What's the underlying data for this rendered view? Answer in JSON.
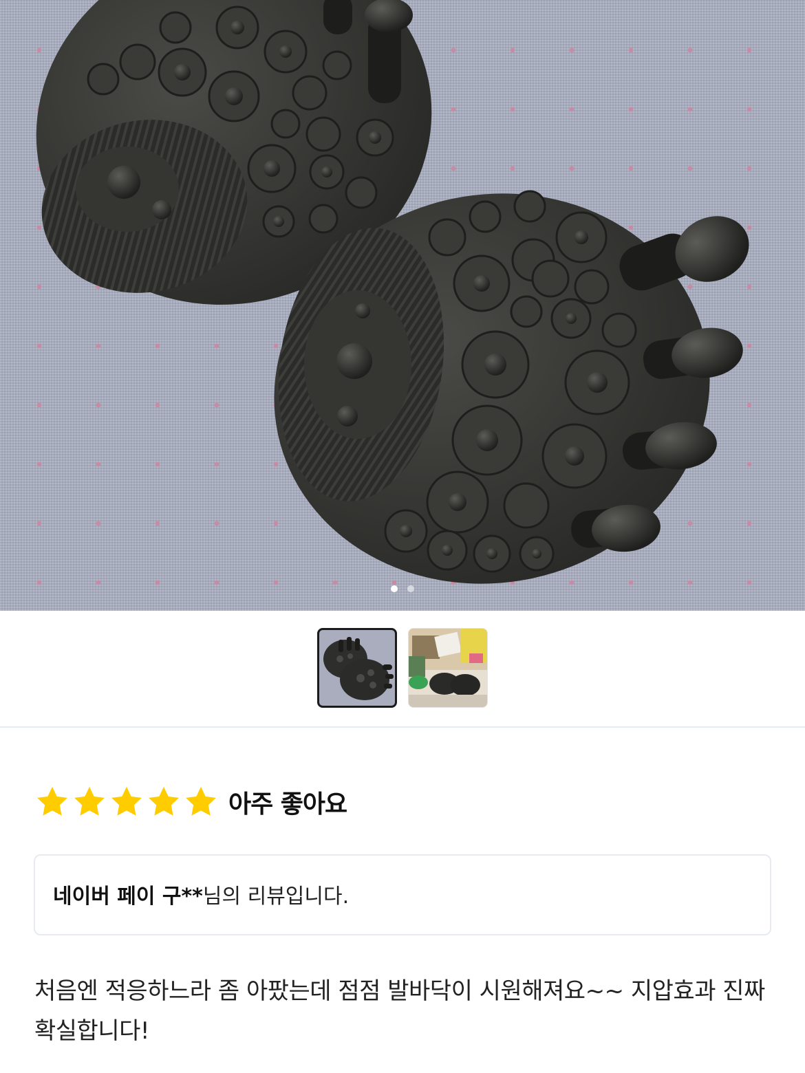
{
  "gallery": {
    "main_image_alt": "foot massage insoles",
    "current_index": 1,
    "total": 2,
    "thumbnails": [
      {
        "name": "thumbnail-1",
        "selected": true
      },
      {
        "name": "thumbnail-2",
        "selected": false
      }
    ]
  },
  "rating": {
    "stars": 5,
    "max_stars": 5,
    "label": "아주 좋아요",
    "star_color": "#ffcc00"
  },
  "review": {
    "reviewer_prefix": "네이버 페이 구**",
    "reviewer_suffix": "님의 리뷰입니다.",
    "text": "처음엔 적응하느라 좀 아팠는데 점점 발바닥이 시원해져요~~ 지압효과 진짜 확실합니다!"
  }
}
